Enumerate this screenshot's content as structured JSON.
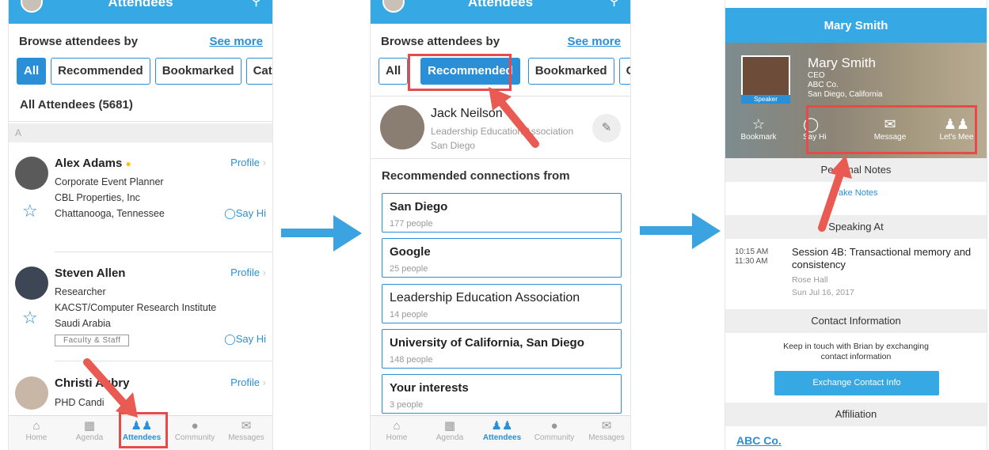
{
  "screen1": {
    "header_title": "Attendees",
    "browse_label": "Browse attendees by",
    "see_more": "See more",
    "filters": [
      "All",
      "Recommended",
      "Bookmarked",
      "Cat"
    ],
    "all_attendees": "All Attendees (5681)",
    "alpha_index": "A",
    "attendees": [
      {
        "name": "Alex Adams",
        "lines": [
          "Corporate Event Planner",
          "CBL Properties, Inc",
          "Chattanooga, Tennessee"
        ],
        "profile": "Profile",
        "say_hi": "Say Hi",
        "tag": ""
      },
      {
        "name": "Steven Allen",
        "lines": [
          "Researcher",
          "KACST/Computer Research Institute",
          "Saudi Arabia"
        ],
        "profile": "Profile",
        "say_hi": "Say Hi",
        "tag": "Faculty & Staff"
      },
      {
        "name": "Christi   Aubry",
        "lines": [
          "PHD Candi"
        ],
        "profile": "Profile",
        "say_hi": "",
        "tag": ""
      }
    ]
  },
  "tabs": [
    "Home",
    "Agenda",
    "Attendees",
    "Community",
    "Messages"
  ],
  "screen2": {
    "header_title": "Attendees",
    "browse_label": "Browse attendees by",
    "see_more": "See more",
    "filters": [
      "All",
      "Recommended",
      "Bookmarked",
      "Cat"
    ],
    "profile": {
      "name": "Jack Neilson",
      "org": "Leadership Education Association",
      "city": "San Diego"
    },
    "recommended_label": "Recommended connections from",
    "connections": [
      {
        "title": "San Diego",
        "sub": "177 people"
      },
      {
        "title": "Google",
        "sub": "25 people"
      },
      {
        "title": "Leadership Education Association",
        "sub": "14 people"
      },
      {
        "title": "University of California, San Diego",
        "sub": "148 people"
      },
      {
        "title": "Your interests",
        "sub": "3 people"
      }
    ]
  },
  "screen3": {
    "header_title": "Mary Smith",
    "name": "Mary Smith",
    "title": "CEO",
    "company": "ABC Co.",
    "location": "San Diego, California",
    "badge": "Speaker",
    "actions": [
      "Bookmark",
      "Say Hi",
      "Message",
      "Let's Mee"
    ],
    "personal_notes": "Personal Notes",
    "take_notes": "Take Notes",
    "speaking_at": "Speaking At",
    "session": {
      "start": "10:15 AM",
      "end": "11:30 AM",
      "title": "Session 4B: Transactional memory and consistency",
      "room": "Rose Hall",
      "date": "Sun Jul 16, 2017"
    },
    "contact_info": "Contact Information",
    "contact_text_1": "Keep in touch with Brian by exchanging",
    "contact_text_2": "contact information",
    "exchange_button": "Exchange Contact Info",
    "affiliation": "Affiliation",
    "affiliation_link": "ABC Co."
  },
  "colors": {
    "accent": "#36a8e3",
    "highlight": "#e84a4a",
    "arrow": "#e95a52",
    "flow_arrow": "#3ba3e0"
  }
}
